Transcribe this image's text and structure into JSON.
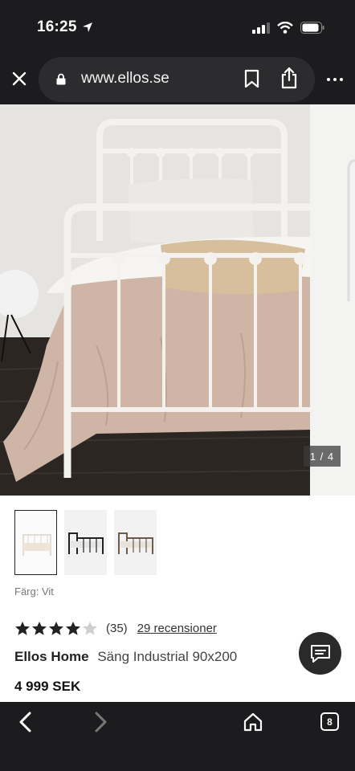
{
  "status_bar": {
    "time": "16:25",
    "icons": [
      "location-arrow-icon",
      "signal-icon",
      "wifi-icon",
      "battery-icon"
    ]
  },
  "browser": {
    "url": "www.ellos.se",
    "icons": [
      "close-icon",
      "lock-icon",
      "bookmark-icon",
      "share-icon",
      "more-icon"
    ]
  },
  "gallery": {
    "counter": "1 / 4",
    "current_image": 1,
    "total_images": 4
  },
  "thumbnails": [
    {
      "variant": "white",
      "selected": true
    },
    {
      "variant": "black",
      "selected": false
    },
    {
      "variant": "brown",
      "selected": false
    }
  ],
  "product": {
    "color_label": "Färg: Vit",
    "rating": 4,
    "rating_max": 5,
    "rating_count": "(35)",
    "reviews_link": "29 recensioner",
    "brand": "Ellos Home",
    "name": "Säng Industrial 90x200",
    "price": "4 999 SEK"
  },
  "toolbar": {
    "tab_count": "8",
    "icons": [
      "back-icon",
      "forward-icon",
      "home-icon",
      "tabs-icon"
    ]
  },
  "colors": {
    "chrome": "#1c1c1e",
    "url_pill": "#2c2c2e",
    "text": "#222222"
  }
}
